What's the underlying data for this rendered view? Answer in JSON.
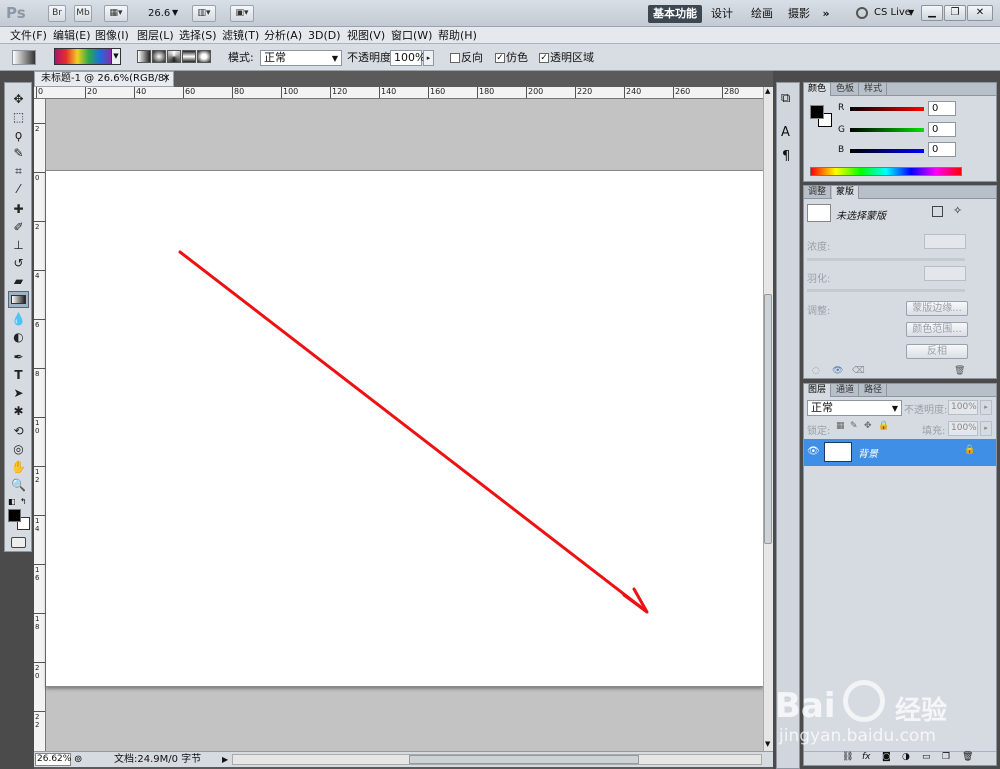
{
  "appbar": {
    "logo": "Ps",
    "br": "Br",
    "mb": "Mb",
    "zoom": "26.6",
    "workspaces": [
      "基本功能",
      "设计",
      "绘画",
      "摄影"
    ],
    "more": "»",
    "cslive": "CS Live"
  },
  "menu": [
    "文件(F)",
    "编辑(E)",
    "图像(I)",
    "图层(L)",
    "选择(S)",
    "滤镜(T)",
    "分析(A)",
    "3D(D)",
    "视图(V)",
    "窗口(W)",
    "帮助(H)"
  ],
  "options": {
    "mode_label": "模式:",
    "mode_value": "正常",
    "opacity_label": "不透明度:",
    "opacity_value": "100%",
    "reverse": "反向",
    "dither": "仿色",
    "transparency": "透明区域"
  },
  "document": {
    "tab_title": "未标题-1 @ 26.6%(RGB/8) *",
    "zoom": "26.62%",
    "doc_info": "文档:24.9M/0 字节"
  },
  "ruler_h": [
    "0",
    "20",
    "40",
    "60",
    "80",
    "100",
    "120",
    "140",
    "160",
    "180",
    "200",
    "220",
    "240",
    "260",
    "280"
  ],
  "ruler_v": [
    "2",
    "0",
    "2",
    "4",
    "6",
    "8",
    "10",
    "12",
    "14",
    "16",
    "18",
    "20",
    "22"
  ],
  "color_panel": {
    "tabs": [
      "颜色",
      "色板",
      "样式"
    ],
    "r_label": "R",
    "g_label": "G",
    "b_label": "B",
    "r": "0",
    "g": "0",
    "b": "0"
  },
  "masks_panel": {
    "tabs": [
      "调整",
      "蒙版"
    ],
    "no_mask": "未选择蒙版",
    "density": "浓度:",
    "feather": "羽化:",
    "refine": "调整:",
    "mask_edge": "蒙版边缘...",
    "color_range": "颜色范围...",
    "invert": "反相"
  },
  "layers_panel": {
    "tabs": [
      "图层",
      "通道",
      "路径"
    ],
    "blend": "正常",
    "opacity_label": "不透明度:",
    "opacity": "100%",
    "lock_label": "锁定:",
    "fill_label": "填充:",
    "fill": "100%",
    "layer_name": "背景"
  },
  "watermark": {
    "brand": "Bai",
    "brand2": "经验",
    "url": "jingyan.baidu.com"
  },
  "colors": {
    "accent": "#3f8fe6",
    "arrow": "#ee1111"
  }
}
